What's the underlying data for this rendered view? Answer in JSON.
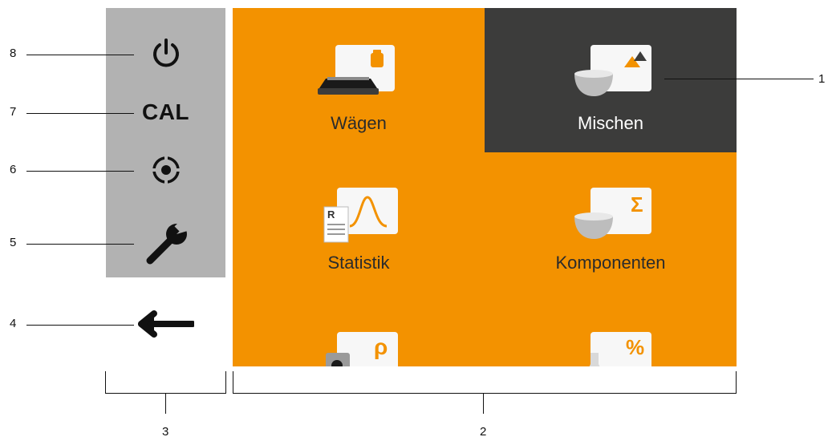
{
  "callouts": [
    "1",
    "2",
    "3",
    "4",
    "5",
    "6",
    "7",
    "8"
  ],
  "side": {
    "power_icon": "power-icon",
    "cal_label": "CAL",
    "zero_icon": "target-icon",
    "settings_icon": "wrench-icon",
    "back_icon": "arrow-left-icon"
  },
  "apps": [
    {
      "label": "Wägen",
      "icon": "scale-icon",
      "selected": false
    },
    {
      "label": "Mischen",
      "icon": "mixing-bowl-icon",
      "selected": true
    },
    {
      "label": "Statistik",
      "icon": "statistics-icon",
      "selected": false
    },
    {
      "label": "Komponenten",
      "icon": "components-sigma-icon",
      "selected": false
    },
    {
      "label": "",
      "icon": "density-rho-icon",
      "selected": false
    },
    {
      "label": "",
      "icon": "percent-flask-icon",
      "selected": false
    }
  ],
  "colors": {
    "accent": "#f39200",
    "selected": "#3c3c3b",
    "sidebar": "#b2b2b2"
  }
}
